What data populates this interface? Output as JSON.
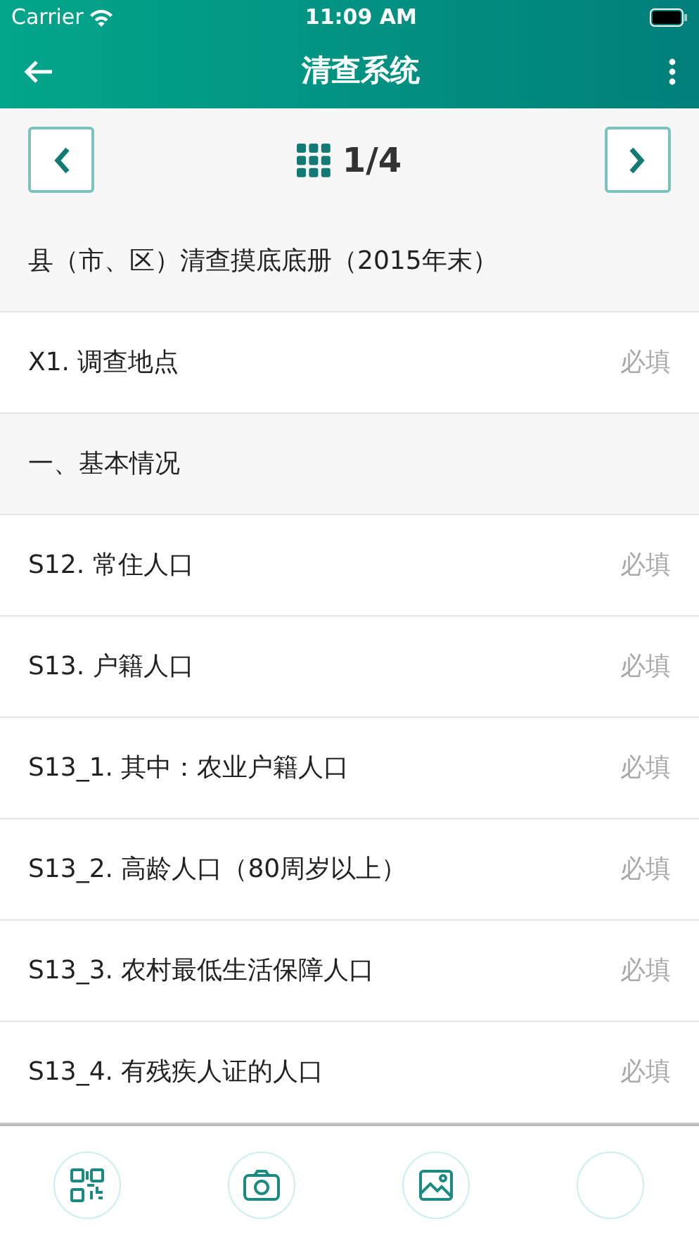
{
  "status_bar": {
    "carrier": "Carrier",
    "time": "11:09 AM"
  },
  "header": {
    "title": "清查系统"
  },
  "pager": {
    "page": "1/4"
  },
  "rows": [
    {
      "kind": "section",
      "label": "县（市、区）清查摸底底册（2015年末）"
    },
    {
      "kind": "field",
      "label": "X1. 调查地点",
      "hint": "必填"
    },
    {
      "kind": "section",
      "label": "一、基本情况"
    },
    {
      "kind": "field",
      "label": "S12. 常住人口",
      "hint": "必填"
    },
    {
      "kind": "field",
      "label": "S13. 户籍人口",
      "hint": "必填"
    },
    {
      "kind": "field",
      "label": "S13_1. 其中：农业户籍人口",
      "hint": "必填"
    },
    {
      "kind": "field",
      "label": "S13_2. 高龄人口（80周岁以上）",
      "hint": "必填"
    },
    {
      "kind": "field",
      "label": "S13_3. 农村最低生活保障人口",
      "hint": "必填"
    },
    {
      "kind": "field",
      "label": "S13_4. 有残疾人证的人口",
      "hint": "必填"
    }
  ],
  "toolbar": [
    {
      "kind": "qr"
    },
    {
      "kind": "camera"
    },
    {
      "kind": "image"
    },
    {
      "kind": "blank"
    }
  ]
}
